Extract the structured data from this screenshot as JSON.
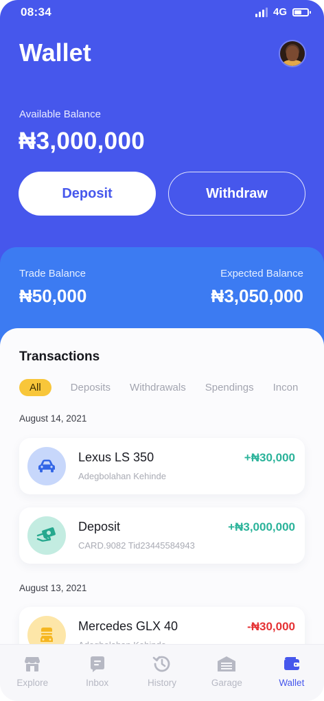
{
  "status_bar": {
    "time": "08:34",
    "network": "4G"
  },
  "header": {
    "title": "Wallet"
  },
  "balance": {
    "label": "Available Balance",
    "amount": "₦3,000,000"
  },
  "actions": {
    "deposit_label": "Deposit",
    "withdraw_label": "Withdraw"
  },
  "summary": {
    "trade_label": "Trade Balance",
    "trade_amount": "₦50,000",
    "expected_label": "Expected Balance",
    "expected_amount": "₦3,050,000"
  },
  "transactions": {
    "title": "Transactions",
    "filters": [
      "All",
      "Deposits",
      "Withdrawals",
      "Spendings",
      "Incon"
    ],
    "active_filter": "All",
    "groups": [
      {
        "date": "August 14, 2021",
        "items": [
          {
            "name": "Lexus LS 350",
            "sub": "Adegbolahan Kehinde",
            "amount": "+₦30,000",
            "icon": "car-icon"
          },
          {
            "name": "Deposit",
            "sub": "CARD.9082 Tid23445584943",
            "amount": "+₦3,000,000",
            "icon": "cash-icon"
          }
        ]
      },
      {
        "date": "August 13, 2021",
        "items": [
          {
            "name": "Mercedes GLX 40",
            "sub": "Adegbolahan Kehinde",
            "amount": "-₦30,000",
            "icon": "garage-car-icon"
          }
        ]
      }
    ]
  },
  "nav": {
    "items": [
      {
        "label": "Explore",
        "icon": "store-icon"
      },
      {
        "label": "Inbox",
        "icon": "chat-icon"
      },
      {
        "label": "History",
        "icon": "history-icon"
      },
      {
        "label": "Garage",
        "icon": "garage-icon"
      },
      {
        "label": "Wallet",
        "icon": "wallet-icon"
      }
    ],
    "active": "Wallet"
  },
  "colors": {
    "primary": "#4657ec",
    "secondary_blue": "#3c7bf2",
    "accent_yellow": "#f8c63a",
    "positive": "#2bb39a",
    "negative": "#e53234"
  }
}
